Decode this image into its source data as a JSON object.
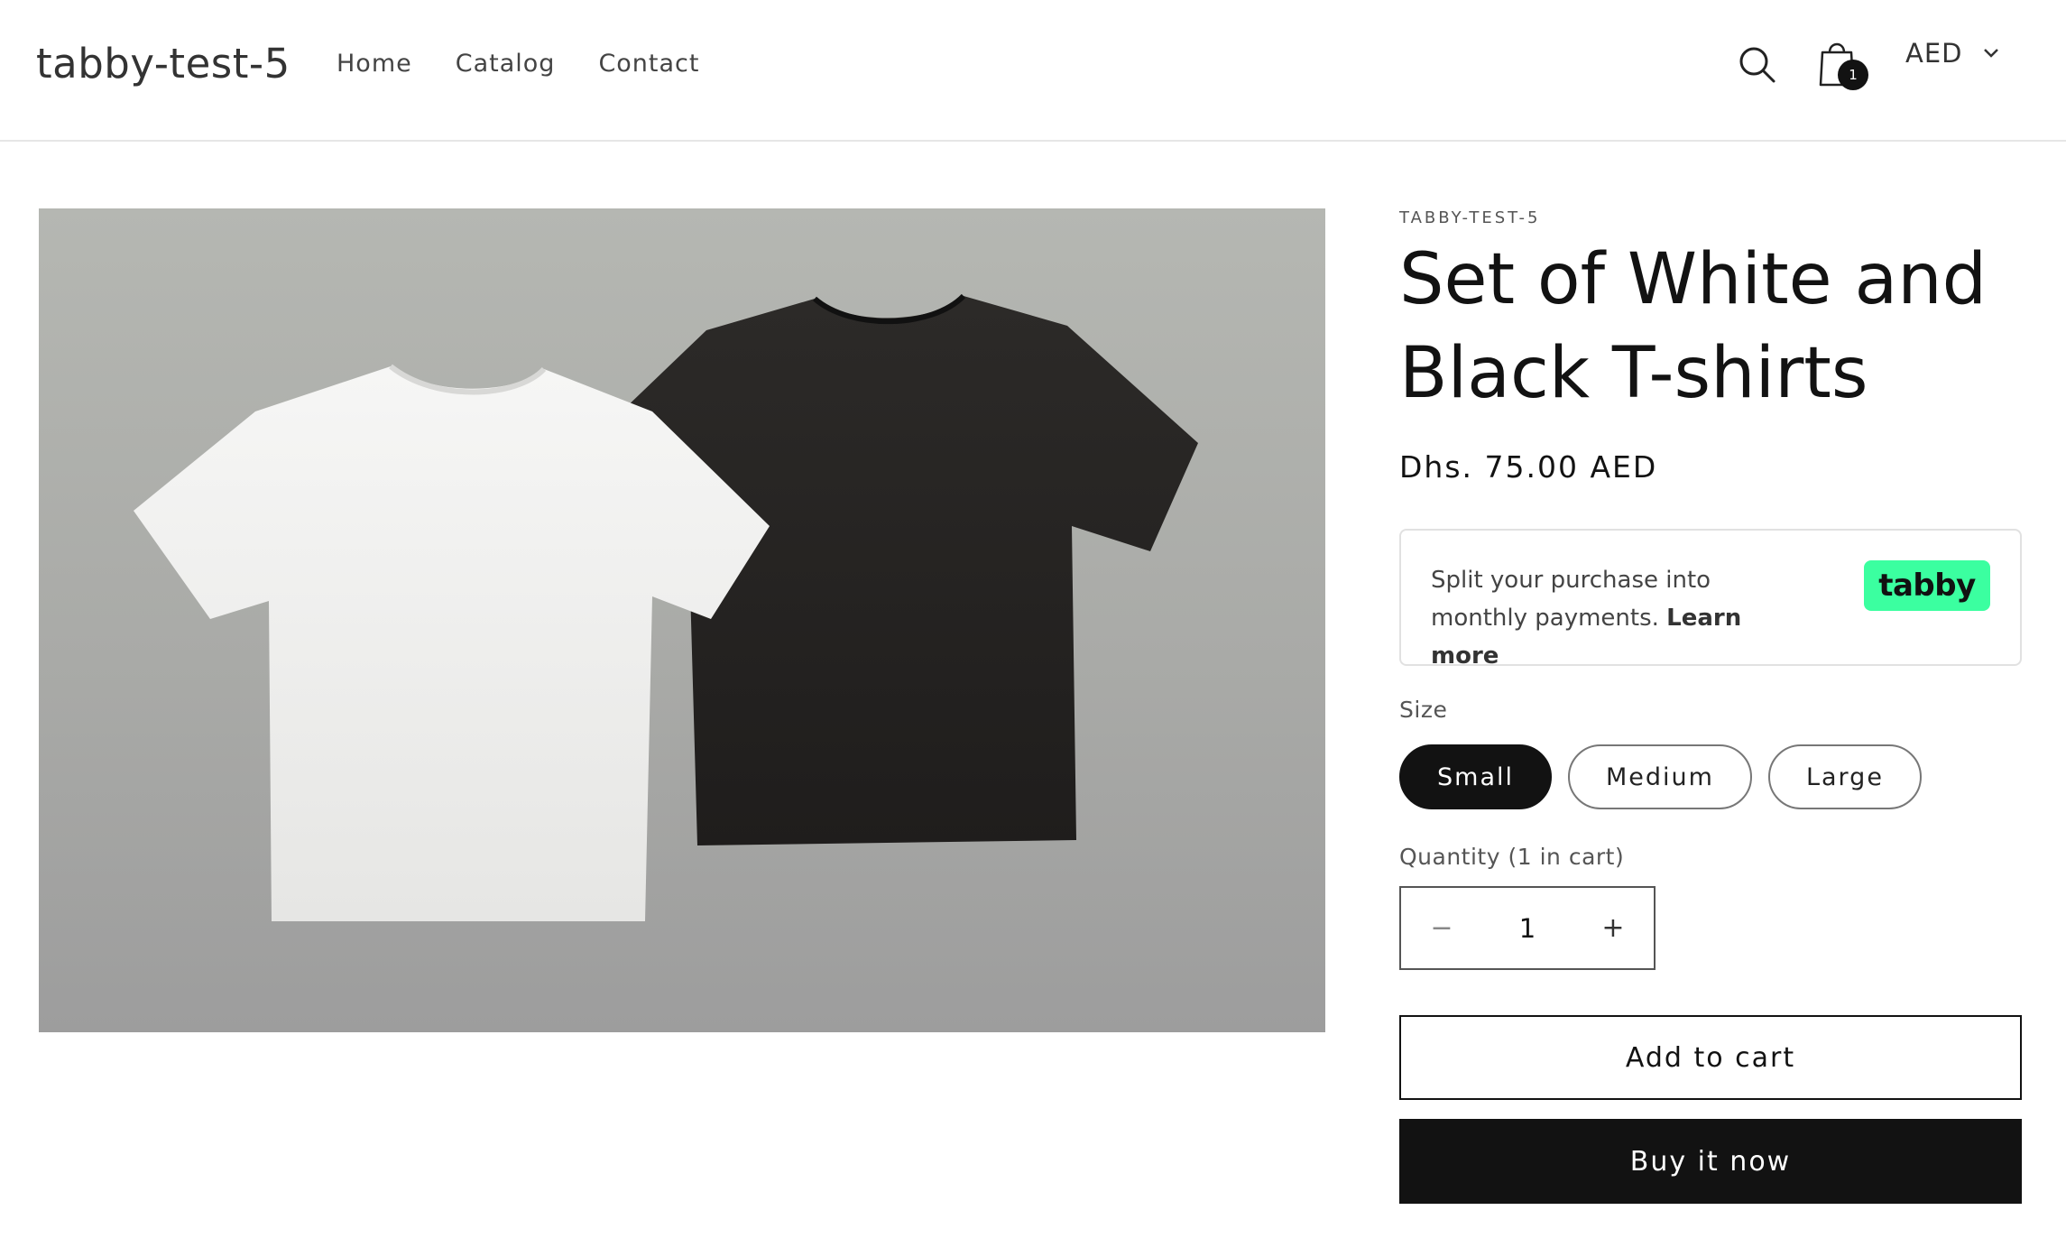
{
  "header": {
    "store_name": "tabby-test-5",
    "nav": [
      {
        "label": "Home"
      },
      {
        "label": "Catalog"
      },
      {
        "label": "Contact"
      }
    ],
    "cart_count": "1",
    "currency": "AED"
  },
  "product": {
    "vendor": "TABBY-TEST-5",
    "title": "Set of White and Black T-shirts",
    "price": "Dhs. 75.00 AED",
    "image_alt": "Set of white and black t-shirts"
  },
  "tabby": {
    "message": "Split your purchase into monthly payments.",
    "learn_more": "Learn more",
    "logo_text": "tabby",
    "color": "#3bffa0"
  },
  "size": {
    "label": "Size",
    "options": [
      {
        "label": "Small",
        "selected": true
      },
      {
        "label": "Medium",
        "selected": false
      },
      {
        "label": "Large",
        "selected": false
      }
    ]
  },
  "quantity": {
    "label": "Quantity (1 in cart)",
    "value": "1",
    "minus": "−",
    "plus": "+"
  },
  "buttons": {
    "add_to_cart": "Add to cart",
    "buy_now": "Buy it now"
  },
  "colors": {
    "text": "#121212",
    "button_dark": "#121212"
  }
}
